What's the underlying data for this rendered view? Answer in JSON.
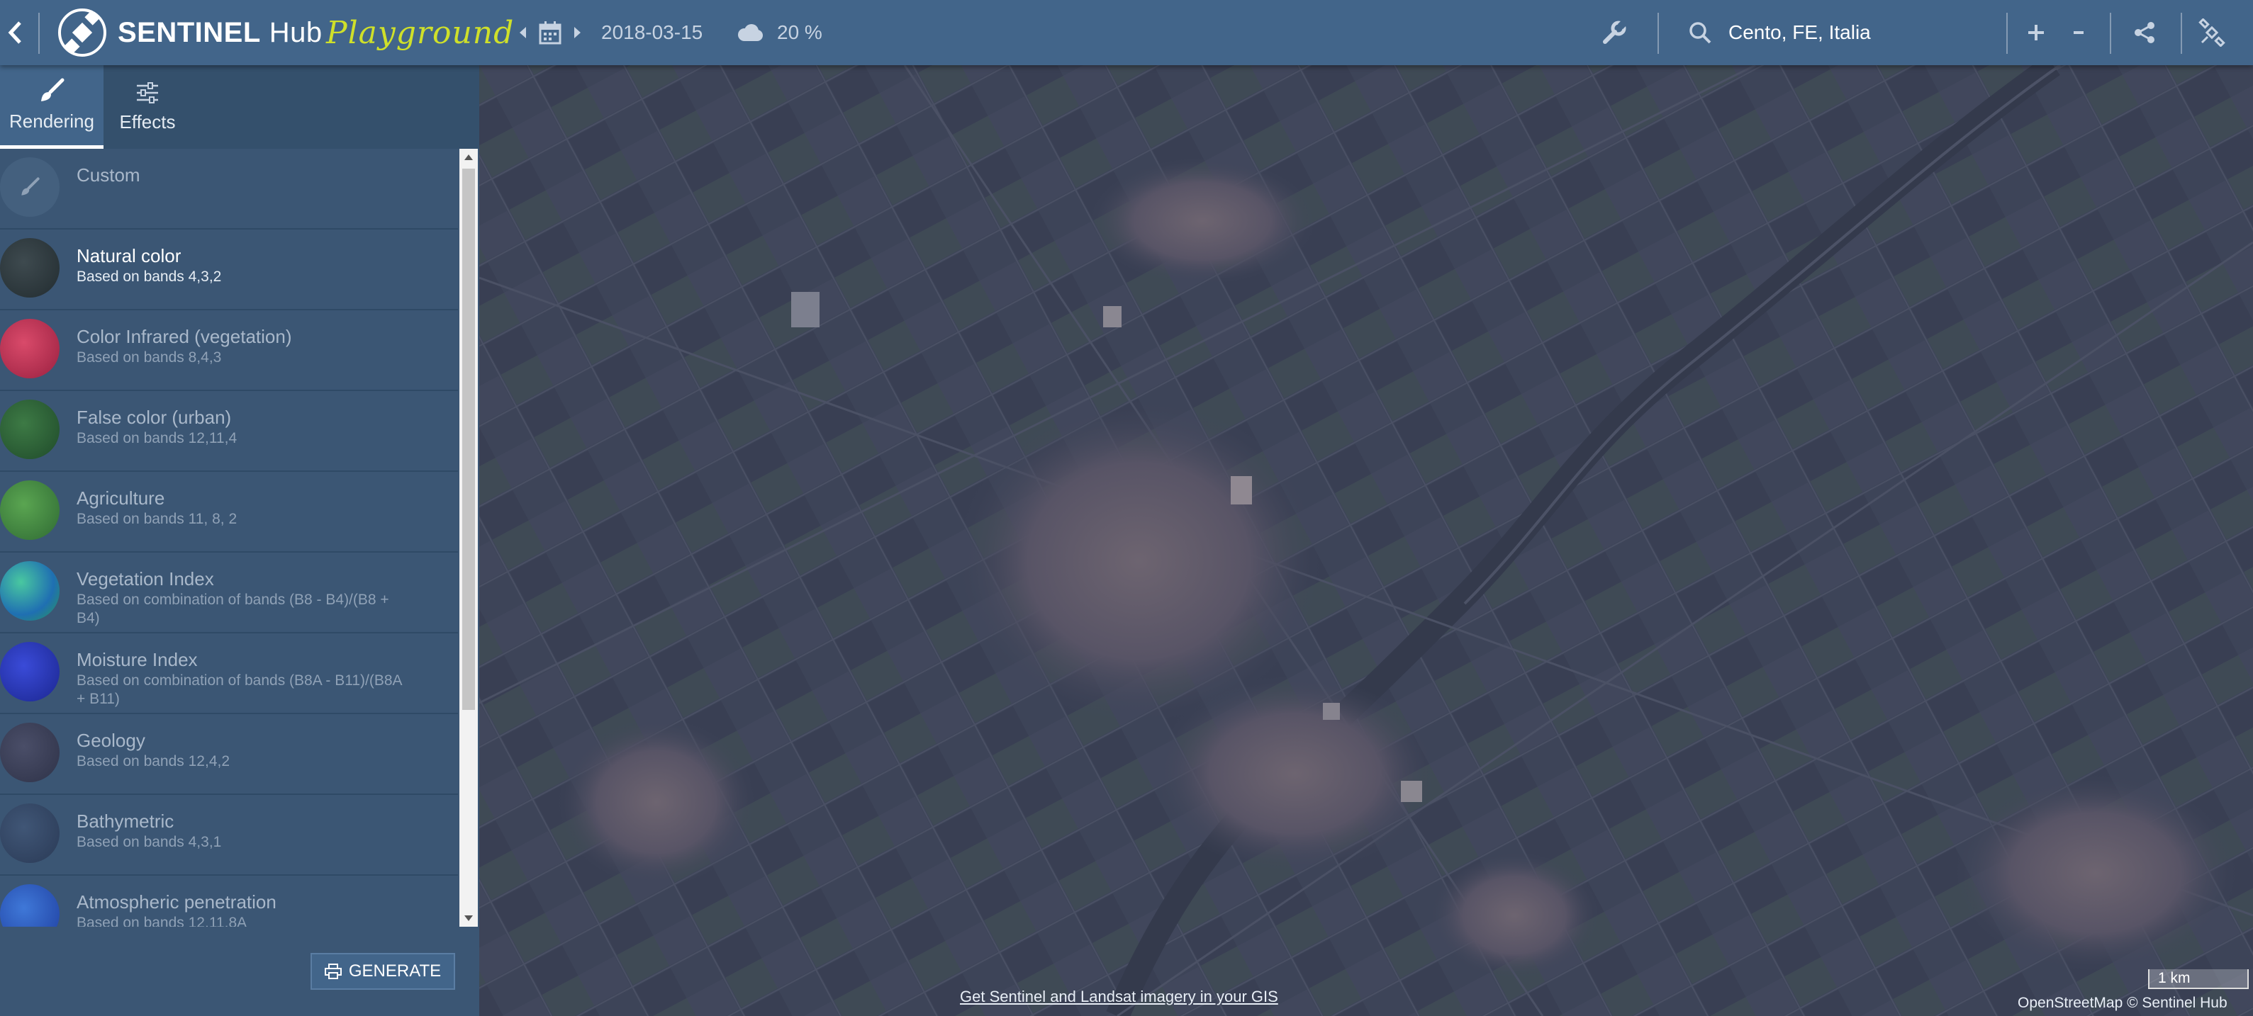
{
  "header": {
    "brand_name": "SENTINEL",
    "brand_hub": "Hub",
    "brand_sub": "Playground",
    "date": "2018-03-15",
    "cloud_coverage": "20 %",
    "search_value": "Cento, FE, Italia",
    "zoom_in": "+",
    "zoom_out": "-"
  },
  "tabs": [
    {
      "label": "Rendering",
      "icon": "brush-icon",
      "active": true
    },
    {
      "label": "Effects",
      "icon": "sliders-icon",
      "active": false
    }
  ],
  "presets": [
    {
      "name": "Custom",
      "desc": "",
      "icon": "brush-icon"
    },
    {
      "name": "Natural color",
      "desc": "Based on bands 4,3,2",
      "selected": true
    },
    {
      "name": "Color Infrared (vegetation)",
      "desc": "Based on bands 8,4,3"
    },
    {
      "name": "False color (urban)",
      "desc": "Based on bands 12,11,4"
    },
    {
      "name": "Agriculture",
      "desc": "Based on bands 11, 8, 2"
    },
    {
      "name": "Vegetation Index",
      "desc": "Based on combination of bands (B8 - B4)/(B8 + B4)"
    },
    {
      "name": "Moisture Index",
      "desc": "Based on combination of bands (B8A - B11)/(B8A + B11)"
    },
    {
      "name": "Geology",
      "desc": "Based on bands 12,4,2"
    },
    {
      "name": "Bathymetric",
      "desc": "Based on bands 4,3,1"
    },
    {
      "name": "Atmospheric penetration",
      "desc": "Based on bands 12,11,8A"
    }
  ],
  "generate_label": "GENERATE",
  "map": {
    "footer_link": "Get Sentinel and Landsat imagery in your GIS",
    "attribution": "OpenStreetMap  © Sentinel Hub",
    "scale": "1 km"
  },
  "colors": {
    "topbar": "#42658a",
    "panel": "#3b5674",
    "accent": "#cfe02a",
    "map": "#3d4458"
  }
}
